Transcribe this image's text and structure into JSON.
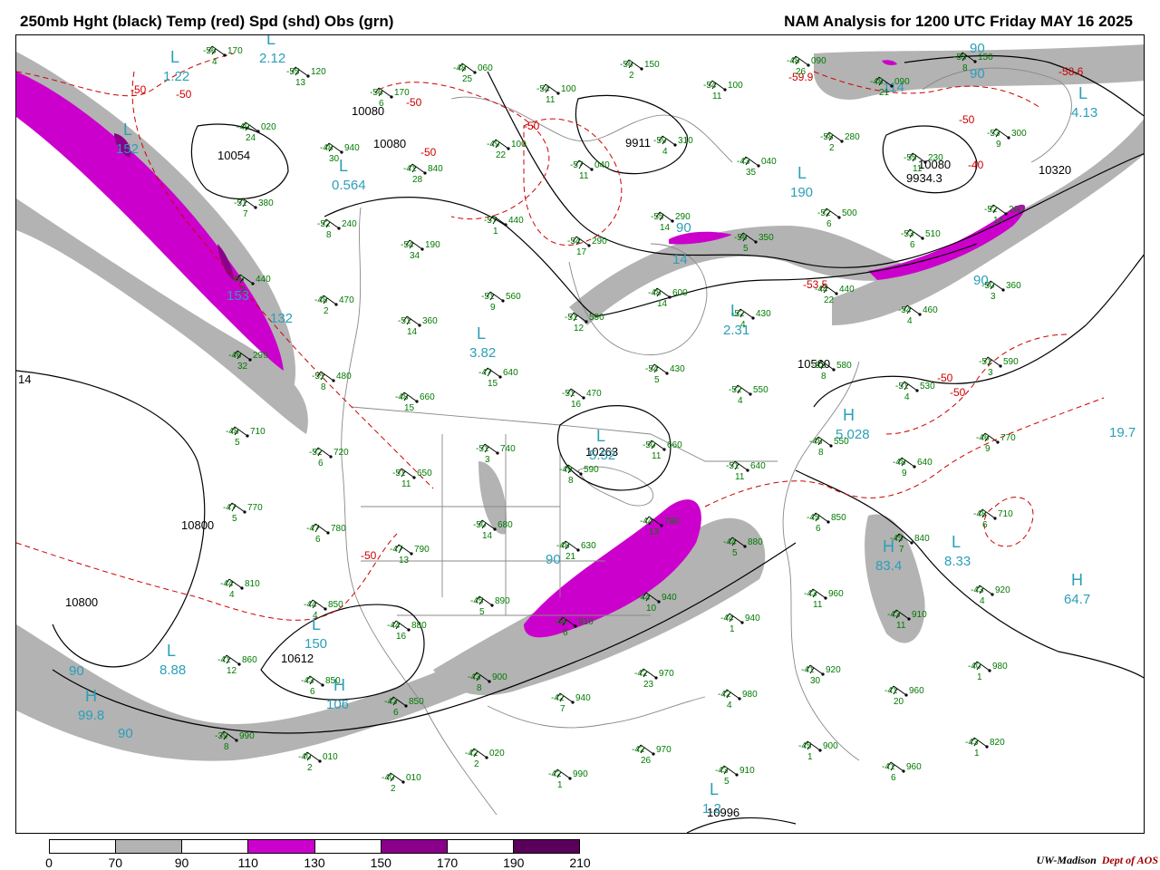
{
  "header": {
    "title_left": "250mb Hght (black) Temp (red) Spd (shd) Obs (grn)",
    "title_right": "NAM Analysis for 1200 UTC Friday  MAY 16 2025"
  },
  "colors": {
    "height_contour": "#000000",
    "temp_contour": "#cc0000",
    "speed_70": "#b3b3b3",
    "speed_110": "#cc00cc",
    "speed_150": "#8a008a",
    "speed_190": "#5a005a",
    "obs": "#007a00",
    "label_cyan": "#2a9fb8",
    "map_lines": "#888888"
  },
  "colorbar": {
    "ticks": [
      "0",
      "70",
      "90",
      "110",
      "130",
      "150",
      "170",
      "190",
      "210"
    ],
    "segments": [
      "#ffffff",
      "#b3b3b3",
      "#ffffff",
      "#cc00cc",
      "#ffffff",
      "#8a008a",
      "#ffffff",
      "#5a005a"
    ]
  },
  "credit": {
    "org": "UW-Madison",
    "dept": "Dept of AOS"
  },
  "height_labels": [
    "10800",
    "10800",
    "10320",
    "10080",
    "10080",
    "10054",
    "10080",
    "10560",
    "10263",
    "10612",
    "10996",
    "9911",
    "9934.3"
  ],
  "temp_labels": [
    "-50",
    "-50",
    "-50",
    "-50",
    "-50",
    "-50",
    "-50",
    "-50",
    "-50",
    "-59.9",
    "-58.6",
    "-53.5",
    "-40"
  ],
  "center_labels": [
    {
      "letter": "L",
      "value": "1.22"
    },
    {
      "letter": "L",
      "value": "2.12"
    },
    {
      "letter": "L",
      "value": "152"
    },
    {
      "letter": "L",
      "value": "0.564"
    },
    {
      "letter": "L",
      "value": "3.82"
    },
    {
      "letter": "L",
      "value": "190"
    },
    {
      "letter": "L",
      "value": "2.31"
    },
    {
      "letter": "L",
      "value": "4.13"
    },
    {
      "letter": "L",
      "value": "5.52"
    },
    {
      "letter": "L",
      "value": "8.33"
    },
    {
      "letter": "L",
      "value": "150"
    },
    {
      "letter": "L",
      "value": "8.88"
    },
    {
      "letter": "L",
      "value": "1.2"
    },
    {
      "letter": "H",
      "value": "99.8"
    },
    {
      "letter": "H",
      "value": "64.7"
    },
    {
      "letter": "H",
      "value": "83.4"
    },
    {
      "letter": "H",
      "value": "106"
    },
    {
      "letter": "H",
      "value": "5.028"
    }
  ],
  "speed_labels": [
    "19.7",
    "90",
    "90",
    "90",
    "90",
    "90",
    "114",
    "132",
    "153",
    "14",
    "90",
    "90"
  ],
  "obs": [
    {
      "temp": "-56",
      "hgt": "170",
      "dew": "4"
    },
    {
      "temp": "-55",
      "hgt": "120",
      "dew": "13"
    },
    {
      "temp": "-56",
      "hgt": "170",
      "dew": "6"
    },
    {
      "temp": "-48",
      "hgt": "060",
      "dew": "25"
    },
    {
      "temp": "-54",
      "hgt": "100",
      "dew": "11"
    },
    {
      "temp": "-56",
      "hgt": "150",
      "dew": "2"
    },
    {
      "temp": "-54",
      "hgt": "100",
      "dew": "11"
    },
    {
      "temp": "-48",
      "hgt": "090",
      "dew": "26"
    },
    {
      "temp": "-48",
      "hgt": "090",
      "dew": "21"
    },
    {
      "temp": "-55",
      "hgt": "150",
      "dew": "8"
    },
    {
      "temp": "-49",
      "hgt": "020",
      "dew": "24"
    },
    {
      "temp": "-48",
      "hgt": "940",
      "dew": "30"
    },
    {
      "temp": "-41",
      "hgt": "840",
      "dew": "28"
    },
    {
      "temp": "-49",
      "hgt": "100",
      "dew": "22"
    },
    {
      "temp": "-57",
      "hgt": "040",
      "dew": "11"
    },
    {
      "temp": "-59",
      "hgt": "310",
      "dew": "4"
    },
    {
      "temp": "-43",
      "hgt": "040",
      "dew": "35"
    },
    {
      "temp": "-58",
      "hgt": "280",
      "dew": "2"
    },
    {
      "temp": "-55",
      "hgt": "230",
      "dew": "11"
    },
    {
      "temp": "-53",
      "hgt": "300",
      "dew": "9"
    },
    {
      "temp": "-51",
      "hgt": "380",
      "dew": "7"
    },
    {
      "temp": "-52",
      "hgt": "240",
      "dew": "8"
    },
    {
      "temp": "-54",
      "hgt": "190",
      "dew": "34"
    },
    {
      "temp": "-57",
      "hgt": "440",
      "dew": "1"
    },
    {
      "temp": "-54",
      "hgt": "290",
      "dew": "17"
    },
    {
      "temp": "-55",
      "hgt": "290",
      "dew": "14"
    },
    {
      "temp": "-56",
      "hgt": "350",
      "dew": "5"
    },
    {
      "temp": "-52",
      "hgt": "500",
      "dew": "6"
    },
    {
      "temp": "-53",
      "hgt": "510",
      "dew": "6"
    },
    {
      "temp": "-52",
      "hgt": "260",
      "dew": "14"
    },
    {
      "temp": "-50",
      "hgt": "440",
      "dew": "2"
    },
    {
      "temp": "-48",
      "hgt": "470",
      "dew": "2"
    },
    {
      "temp": "-51",
      "hgt": "360",
      "dew": "14"
    },
    {
      "temp": "-51",
      "hgt": "560",
      "dew": "9"
    },
    {
      "temp": "-51",
      "hgt": "590",
      "dew": "12"
    },
    {
      "temp": "-48",
      "hgt": "600",
      "dew": "14"
    },
    {
      "temp": "-52",
      "hgt": "430",
      "dew": "4"
    },
    {
      "temp": "-44",
      "hgt": "440",
      "dew": "22"
    },
    {
      "temp": "-54",
      "hgt": "460",
      "dew": "4"
    },
    {
      "temp": "-50",
      "hgt": "360",
      "dew": "3"
    },
    {
      "temp": "-46",
      "hgt": "290",
      "dew": "32"
    },
    {
      "temp": "-51",
      "hgt": "480",
      "dew": "8"
    },
    {
      "temp": "-48",
      "hgt": "660",
      "dew": "15"
    },
    {
      "temp": "-47",
      "hgt": "640",
      "dew": "15"
    },
    {
      "temp": "-51",
      "hgt": "470",
      "dew": "16"
    },
    {
      "temp": "-54",
      "hgt": "430",
      "dew": "5"
    },
    {
      "temp": "-52",
      "hgt": "550",
      "dew": "4"
    },
    {
      "temp": "-52",
      "hgt": "580",
      "dew": "8"
    },
    {
      "temp": "-51",
      "hgt": "530",
      "dew": "4"
    },
    {
      "temp": "-51",
      "hgt": "590",
      "dew": "3"
    },
    {
      "temp": "-48",
      "hgt": "710",
      "dew": "5"
    },
    {
      "temp": "-52",
      "hgt": "720",
      "dew": "6"
    },
    {
      "temp": "-51",
      "hgt": "650",
      "dew": "11"
    },
    {
      "temp": "-51",
      "hgt": "740",
      "dew": "3"
    },
    {
      "temp": "-49",
      "hgt": "590",
      "dew": "8"
    },
    {
      "temp": "-50",
      "hgt": "660",
      "dew": "11"
    },
    {
      "temp": "-51",
      "hgt": "640",
      "dew": "11"
    },
    {
      "temp": "-48",
      "hgt": "550",
      "dew": "8"
    },
    {
      "temp": "-48",
      "hgt": "640",
      "dew": "9"
    },
    {
      "temp": "-46",
      "hgt": "770",
      "dew": "9"
    },
    {
      "temp": "-47",
      "hgt": "770",
      "dew": "5"
    },
    {
      "temp": "-47",
      "hgt": "780",
      "dew": "6"
    },
    {
      "temp": "-47",
      "hgt": "790",
      "dew": "13"
    },
    {
      "temp": "-50",
      "hgt": "680",
      "dew": "14"
    },
    {
      "temp": "-48",
      "hgt": "630",
      "dew": "21"
    },
    {
      "temp": "-44",
      "hgt": "780",
      "dew": "13"
    },
    {
      "temp": "-44",
      "hgt": "880",
      "dew": "5"
    },
    {
      "temp": "-45",
      "hgt": "850",
      "dew": "6"
    },
    {
      "temp": "-45",
      "hgt": "840",
      "dew": "7"
    },
    {
      "temp": "-48",
      "hgt": "710",
      "dew": "6"
    },
    {
      "temp": "-44",
      "hgt": "810",
      "dew": "4"
    },
    {
      "temp": "-44",
      "hgt": "850",
      "dew": "4"
    },
    {
      "temp": "-44",
      "hgt": "880",
      "dew": "16"
    },
    {
      "temp": "-45",
      "hgt": "890",
      "dew": "5"
    },
    {
      "temp": "-44",
      "hgt": "910",
      "dew": "6"
    },
    {
      "temp": "-44",
      "hgt": "940",
      "dew": "10"
    },
    {
      "temp": "-44",
      "hgt": "940",
      "dew": "1"
    },
    {
      "temp": "-43",
      "hgt": "960",
      "dew": "11"
    },
    {
      "temp": "-43",
      "hgt": "910",
      "dew": "11"
    },
    {
      "temp": "-43",
      "hgt": "920",
      "dew": "4"
    },
    {
      "temp": "-41",
      "hgt": "860",
      "dew": "12"
    },
    {
      "temp": "-43",
      "hgt": "850",
      "dew": "6"
    },
    {
      "temp": "-43",
      "hgt": "850",
      "dew": "6"
    },
    {
      "temp": "-43",
      "hgt": "900",
      "dew": "8"
    },
    {
      "temp": "-42",
      "hgt": "940",
      "dew": "7"
    },
    {
      "temp": "-42",
      "hgt": "970",
      "dew": "23"
    },
    {
      "temp": "-42",
      "hgt": "980",
      "dew": "4"
    },
    {
      "temp": "-41",
      "hgt": "920",
      "dew": "30"
    },
    {
      "temp": "-41",
      "hgt": "960",
      "dew": "20"
    },
    {
      "temp": "-40",
      "hgt": "980",
      "dew": "1"
    },
    {
      "temp": "-39",
      "hgt": "990",
      "dew": "8"
    },
    {
      "temp": "-40",
      "hgt": "010",
      "dew": "2"
    },
    {
      "temp": "-40",
      "hgt": "010",
      "dew": "2"
    },
    {
      "temp": "-42",
      "hgt": "020",
      "dew": "2"
    },
    {
      "temp": "-42",
      "hgt": "990",
      "dew": "1"
    },
    {
      "temp": "-42",
      "hgt": "970",
      "dew": "26"
    },
    {
      "temp": "-43",
      "hgt": "910",
      "dew": "5"
    },
    {
      "temp": "-45",
      "hgt": "900",
      "dew": "1"
    },
    {
      "temp": "-41",
      "hgt": "960",
      "dew": "6"
    },
    {
      "temp": "-43",
      "hgt": "820",
      "dew": "1"
    }
  ],
  "edge_label": "14"
}
